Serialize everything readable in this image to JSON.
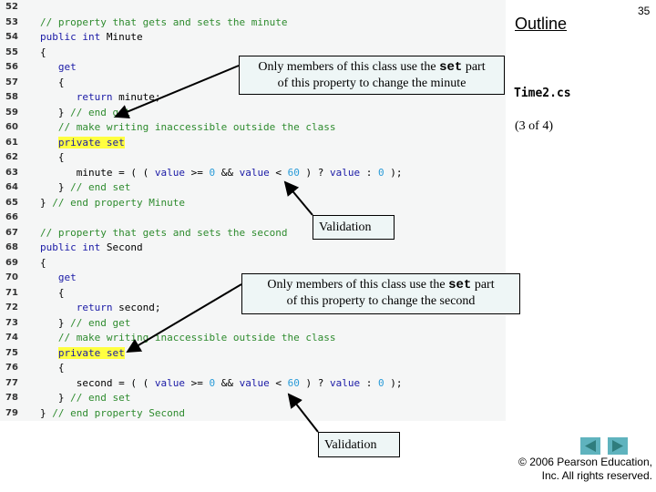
{
  "slide": {
    "number": "35",
    "outline_label": "Outline",
    "filename": "Time2.cs",
    "page_info": "(3 of 4)",
    "copyright_line1": "© 2006 Pearson Education,",
    "copyright_line2": "Inc.  All rights reserved.",
    "nav": {
      "prev_icon": "prev-triangle-icon",
      "next_icon": "next-triangle-icon"
    }
  },
  "code": {
    "lines": [
      {
        "n": "52",
        "text": ""
      },
      {
        "n": "53",
        "text": "// property that gets and sets the minute"
      },
      {
        "n": "54",
        "text": "public int Minute"
      },
      {
        "n": "55",
        "text": "{"
      },
      {
        "n": "56",
        "text": "   get"
      },
      {
        "n": "57",
        "text": "   {"
      },
      {
        "n": "58",
        "text": "      return minute;"
      },
      {
        "n": "59",
        "text": "   } // end get"
      },
      {
        "n": "60",
        "text": "   // make writing inaccessible outside the class"
      },
      {
        "n": "61",
        "text": "   private set"
      },
      {
        "n": "62",
        "text": "   {"
      },
      {
        "n": "63",
        "text": "      minute = ( ( value >= 0 && value < 60 ) ? value : 0 );"
      },
      {
        "n": "64",
        "text": "   } // end set"
      },
      {
        "n": "65",
        "text": "} // end property Minute"
      },
      {
        "n": "66",
        "text": ""
      },
      {
        "n": "67",
        "text": "// property that gets and sets the second"
      },
      {
        "n": "68",
        "text": "public int Second"
      },
      {
        "n": "69",
        "text": "{"
      },
      {
        "n": "70",
        "text": "   get"
      },
      {
        "n": "71",
        "text": "   {"
      },
      {
        "n": "72",
        "text": "      return second;"
      },
      {
        "n": "73",
        "text": "   } // end get"
      },
      {
        "n": "74",
        "text": "   // make writing inaccessible outside the class"
      },
      {
        "n": "75",
        "text": "   private set"
      },
      {
        "n": "76",
        "text": "   {"
      },
      {
        "n": "77",
        "text": "      second = ( ( value >= 0 && value < 60 ) ? value : 0 );"
      },
      {
        "n": "78",
        "text": "   } // end set"
      },
      {
        "n": "79",
        "text": "} // end property Second"
      }
    ]
  },
  "callouts": {
    "minute_set": {
      "line1_pre": "Only members of this class use the ",
      "line1_code": "set",
      "line1_post": " part",
      "line2": "of this property to change the minute"
    },
    "validation1": {
      "text": "Validation"
    },
    "second_set": {
      "line1_pre": "Only members of this class use the ",
      "line1_code": "set",
      "line1_post": " part",
      "line2": "of this property to change the second"
    },
    "validation2": {
      "text": "Validation"
    }
  },
  "colors": {
    "keyword": "#1a1aa6",
    "comment": "#2e8b2e",
    "number": "#2a9bd8",
    "highlight": "#ffff40",
    "nav_button": "#5fb3be"
  }
}
